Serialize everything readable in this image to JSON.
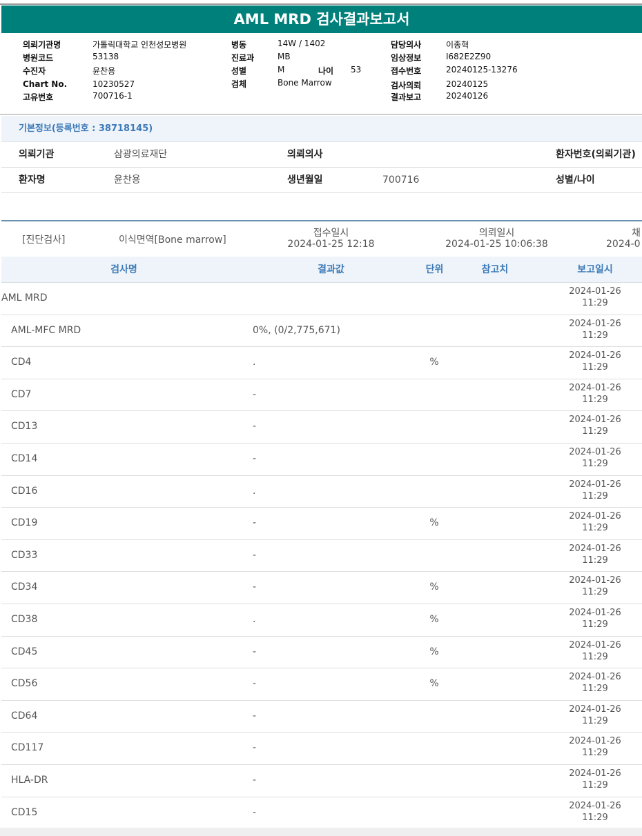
{
  "title": "AML MRD 검사결과보고서",
  "info": {
    "col1": [
      {
        "label": "의뢰기관명",
        "value": "가톨릭대학교 인천성모병원"
      },
      {
        "label": "병원코드",
        "value": "53138"
      },
      {
        "label": "수진자",
        "value": "윤찬용"
      },
      {
        "label": "Chart No.",
        "value": "10230527"
      },
      {
        "label": "고유번호",
        "value": "700716-1"
      }
    ],
    "col2": [
      {
        "label": "병동",
        "value": "14W / 1402"
      },
      {
        "label": "진료과",
        "value": "MB"
      },
      {
        "label": "성별",
        "value": "M"
      },
      {
        "label": "검체",
        "value": "Bone Marrow"
      }
    ],
    "age_label": "나이",
    "age_value": "53",
    "col3": [
      {
        "label": "담당의사",
        "value": "이종혁"
      },
      {
        "label": "임상정보",
        "value": "I682E2Z90"
      },
      {
        "label": "접수번호",
        "value": "20240125-13276"
      },
      {
        "label": "검사의뢰",
        "value": "20240125"
      },
      {
        "label": "결과보고",
        "value": "20240126"
      }
    ]
  },
  "basic": {
    "header": "기본정보(등록번호 : 38718145)",
    "row1": {
      "l1": "의뢰기관",
      "v1": "삼광의료재단",
      "l2": "의뢰의사",
      "v2": "",
      "l3": "환자번호(의뢰기관)"
    },
    "row2": {
      "l1": "환자명",
      "v1": "윤찬용",
      "l2": "생년월일",
      "v2": "700716",
      "l3": "성별/나이"
    }
  },
  "summary": {
    "category": "[진단검사]",
    "test": "이식면역[Bone marrow]",
    "received_label": "접수일시",
    "received": "2024-01-25 12:18",
    "requested_label": "의뢰일시",
    "requested": "2024-01-25 10:06:38",
    "extra_label": "채",
    "extra": "2024-0"
  },
  "table": {
    "headers": {
      "name": "검사명",
      "result": "결과값",
      "unit": "단위",
      "ref": "참고치",
      "date": "보고일시"
    },
    "rows": [
      {
        "name": "AML MRD",
        "result": "",
        "unit": "",
        "ref": "",
        "date": "2024-01-26",
        "time": "11:29",
        "top": true
      },
      {
        "name": "AML-MFC MRD",
        "result": "0%, (0/2,775,671)",
        "unit": "",
        "ref": "",
        "date": "2024-01-26",
        "time": "11:29"
      },
      {
        "name": "CD4",
        "result": ".",
        "unit": "%",
        "ref": "",
        "date": "2024-01-26",
        "time": "11:29"
      },
      {
        "name": "CD7",
        "result": "-",
        "unit": "",
        "ref": "",
        "date": "2024-01-26",
        "time": "11:29"
      },
      {
        "name": "CD13",
        "result": "-",
        "unit": "",
        "ref": "",
        "date": "2024-01-26",
        "time": "11:29"
      },
      {
        "name": "CD14",
        "result": "-",
        "unit": "",
        "ref": "",
        "date": "2024-01-26",
        "time": "11:29"
      },
      {
        "name": "CD16",
        "result": ".",
        "unit": "",
        "ref": "",
        "date": "2024-01-26",
        "time": "11:29"
      },
      {
        "name": "CD19",
        "result": "-",
        "unit": "%",
        "ref": "",
        "date": "2024-01-26",
        "time": "11:29"
      },
      {
        "name": "CD33",
        "result": "-",
        "unit": "",
        "ref": "",
        "date": "2024-01-26",
        "time": "11:29"
      },
      {
        "name": "CD34",
        "result": "-",
        "unit": "%",
        "ref": "",
        "date": "2024-01-26",
        "time": "11:29"
      },
      {
        "name": "CD38",
        "result": ".",
        "unit": "%",
        "ref": "",
        "date": "2024-01-26",
        "time": "11:29"
      },
      {
        "name": "CD45",
        "result": "-",
        "unit": "%",
        "ref": "",
        "date": "2024-01-26",
        "time": "11:29"
      },
      {
        "name": "CD56",
        "result": "-",
        "unit": "%",
        "ref": "",
        "date": "2024-01-26",
        "time": "11:29"
      },
      {
        "name": "CD64",
        "result": "-",
        "unit": "",
        "ref": "",
        "date": "2024-01-26",
        "time": "11:29"
      },
      {
        "name": "CD117",
        "result": "-",
        "unit": "",
        "ref": "",
        "date": "2024-01-26",
        "time": "11:29"
      },
      {
        "name": "HLA-DR",
        "result": "-",
        "unit": "",
        "ref": "",
        "date": "2024-01-26",
        "time": "11:29"
      },
      {
        "name": "CD15",
        "result": "-",
        "unit": "",
        "ref": "",
        "date": "2024-01-26",
        "time": "11:29"
      }
    ]
  },
  "colors": {
    "title_bar": "#00807a",
    "accent_blue": "#3d7ab8",
    "header_bg": "#eef4f9"
  }
}
